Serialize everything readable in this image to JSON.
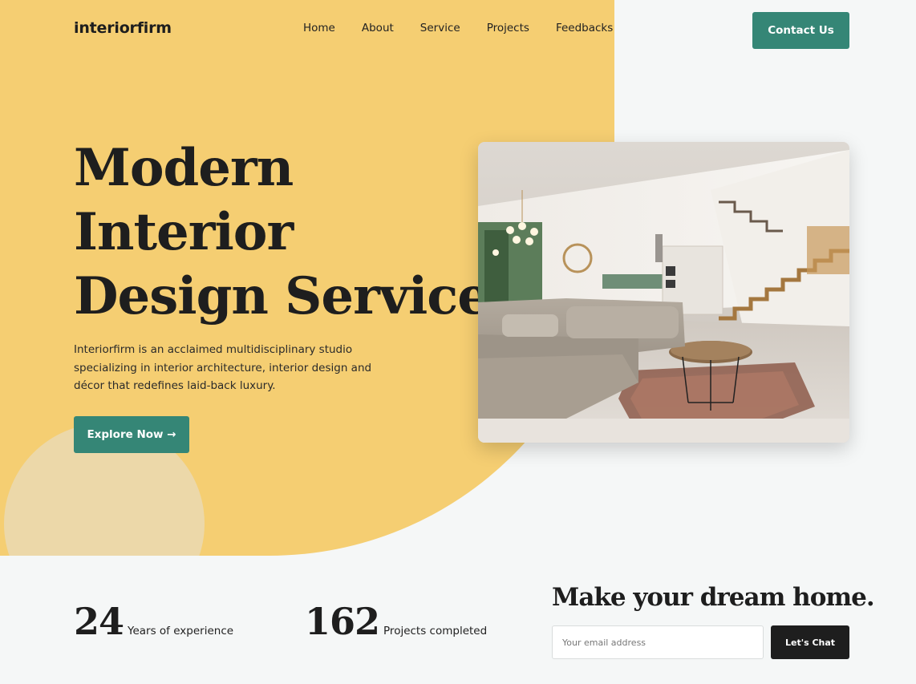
{
  "brand": {
    "name": "interiorfirm"
  },
  "nav": {
    "items": [
      {
        "label": "Home"
      },
      {
        "label": "About"
      },
      {
        "label": "Service"
      },
      {
        "label": "Projects"
      },
      {
        "label": "Feedbacks"
      }
    ],
    "contact_label": "Contact Us"
  },
  "hero": {
    "title_lines": [
      "Modern",
      "Interior",
      "Design Service"
    ],
    "description": "Interiorfirm is an acclaimed multidisciplinary studio specializing in interior architecture, interior design and décor that redefines laid-back luxury.",
    "cta_label": "Explore Now →",
    "image_icon": "living-room-photo"
  },
  "stats": [
    {
      "value": "24",
      "label": "Years of experience"
    },
    {
      "value": "162",
      "label": "Projects completed"
    }
  ],
  "newsletter": {
    "title": "Make your dream home.",
    "email_placeholder": "Your email address",
    "button_label": "Let's Chat"
  },
  "colors": {
    "accent": "#358676",
    "hero_bg": "#f5ce72",
    "circle": "#ecd8a9",
    "page_bg": "#f5f7f7",
    "dark": "#1e1e1e"
  }
}
